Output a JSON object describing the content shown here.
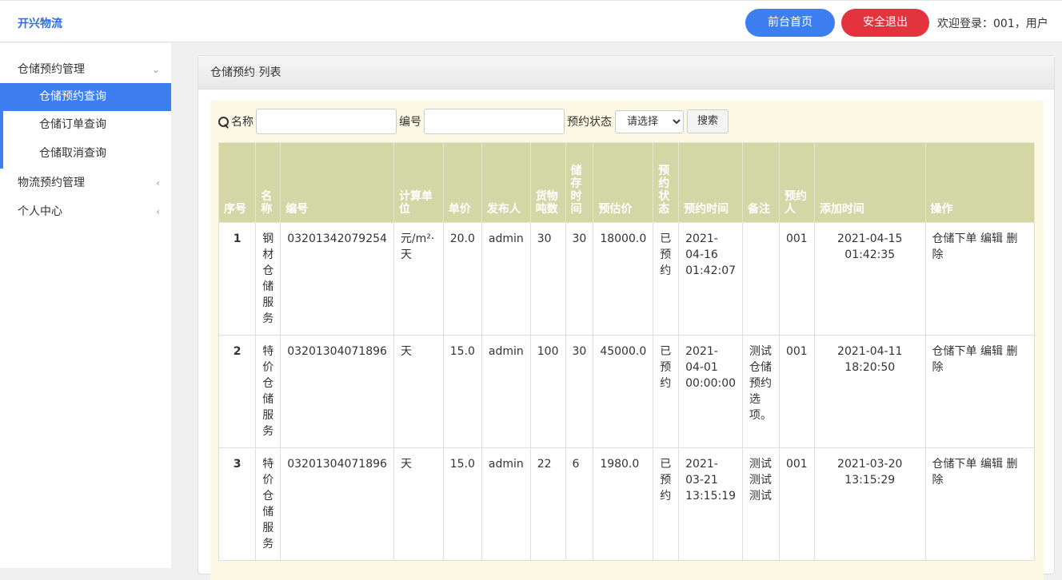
{
  "header": {
    "brand": "开兴物流",
    "home_button": "前台首页",
    "logout_button": "安全退出",
    "welcome": "欢迎登录：001，用户"
  },
  "sidebar": {
    "groups": [
      {
        "label": "仓储预约管理",
        "arrow": "⌄"
      },
      {
        "label": "物流预约管理",
        "arrow": "‹"
      },
      {
        "label": "个人中心",
        "arrow": "‹"
      }
    ],
    "sub_items": [
      {
        "label": "仓储预约查询"
      },
      {
        "label": "仓储订单查询"
      },
      {
        "label": "仓储取消查询"
      }
    ]
  },
  "panel": {
    "title": "仓储预约 列表"
  },
  "search": {
    "name_label": "名称",
    "name_value": "",
    "code_label": "编号",
    "code_value": "",
    "status_label": "预约状态",
    "status_selected": "请选择",
    "search_button": "搜索"
  },
  "table": {
    "headers": [
      "序号",
      "名称",
      "编号",
      "计算单位",
      "单价",
      "发布人",
      "货物吨数",
      "储存时间",
      "预估价",
      "预约状态",
      "预约时间",
      "备注",
      "预约人",
      "添加时间",
      "操作"
    ],
    "rows": [
      {
        "idx": "1",
        "name": "钢材仓储服务",
        "code": "03201342079254",
        "unit": "元/m²·天",
        "price": "20.0",
        "publisher": "admin",
        "tons": "30",
        "days": "30",
        "estimate": "18000.0",
        "status": "已预约",
        "book_time": "2021-04-16 01:42:07",
        "remark": "",
        "booker": "001",
        "add_time": "2021-04-15 01:42:35"
      },
      {
        "idx": "2",
        "name": "特价仓储服务",
        "code": "03201304071896",
        "unit": "天",
        "price": "15.0",
        "publisher": "admin",
        "tons": "100",
        "days": "30",
        "estimate": "45000.0",
        "status": "已预约",
        "book_time": "2021-04-01 00:00:00",
        "remark": "测试仓储预约选项。",
        "booker": "001",
        "add_time": "2021-04-11 18:20:50"
      },
      {
        "idx": "3",
        "name": "特价仓储服务",
        "code": "03201304071896",
        "unit": "天",
        "price": "15.0",
        "publisher": "admin",
        "tons": "22",
        "days": "6",
        "estimate": "1980.0",
        "status": "已预约",
        "book_time": "2021-03-21 13:15:19",
        "remark": "测试测试测试",
        "booker": "001",
        "add_time": "2021-03-20 13:15:29"
      }
    ],
    "ops": {
      "order": "仓储下单",
      "edit": "编辑",
      "delete": "删除"
    }
  }
}
